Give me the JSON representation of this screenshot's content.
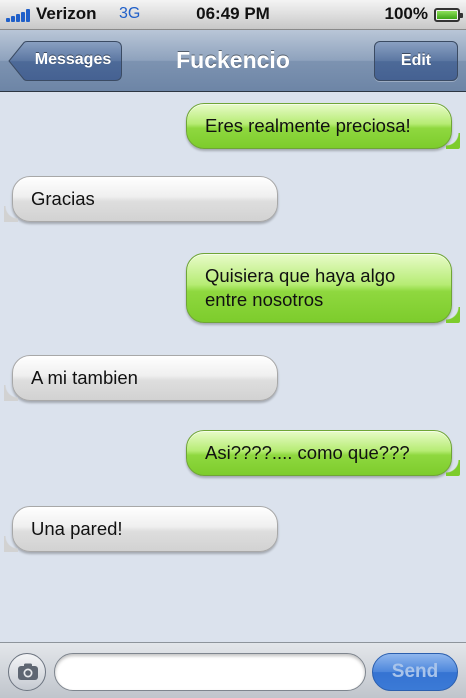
{
  "status_bar": {
    "carrier": "Verizon",
    "network": "3G",
    "time": "06:49 PM",
    "battery": "100%",
    "battery_level": 1.0
  },
  "nav": {
    "back_label": "Messages",
    "title": "Fuckencio",
    "edit_label": "Edit"
  },
  "messages": [
    {
      "direction": "sent",
      "text": "Eres realmente preciosa!"
    },
    {
      "direction": "received",
      "text": "Gracias"
    },
    {
      "direction": "sent",
      "text": "Quisiera que haya algo entre nosotros"
    },
    {
      "direction": "received",
      "text": "A mi tambien"
    },
    {
      "direction": "sent",
      "text": "Asi????.... como que???"
    },
    {
      "direction": "received",
      "text": "Una pared!"
    }
  ],
  "composer": {
    "placeholder": "",
    "value": "",
    "send_label": "Send"
  },
  "icons": {
    "signal": "signal-bars-icon",
    "battery": "battery-icon",
    "back": "back-arrow-button",
    "camera": "camera-icon"
  },
  "colors": {
    "sent_bubble": "#8fd83f",
    "received_bubble": "#e6e6e6",
    "background": "#dbe2ed",
    "nav_bar": "#7d93b1",
    "send_button": "#3b7ad6"
  }
}
